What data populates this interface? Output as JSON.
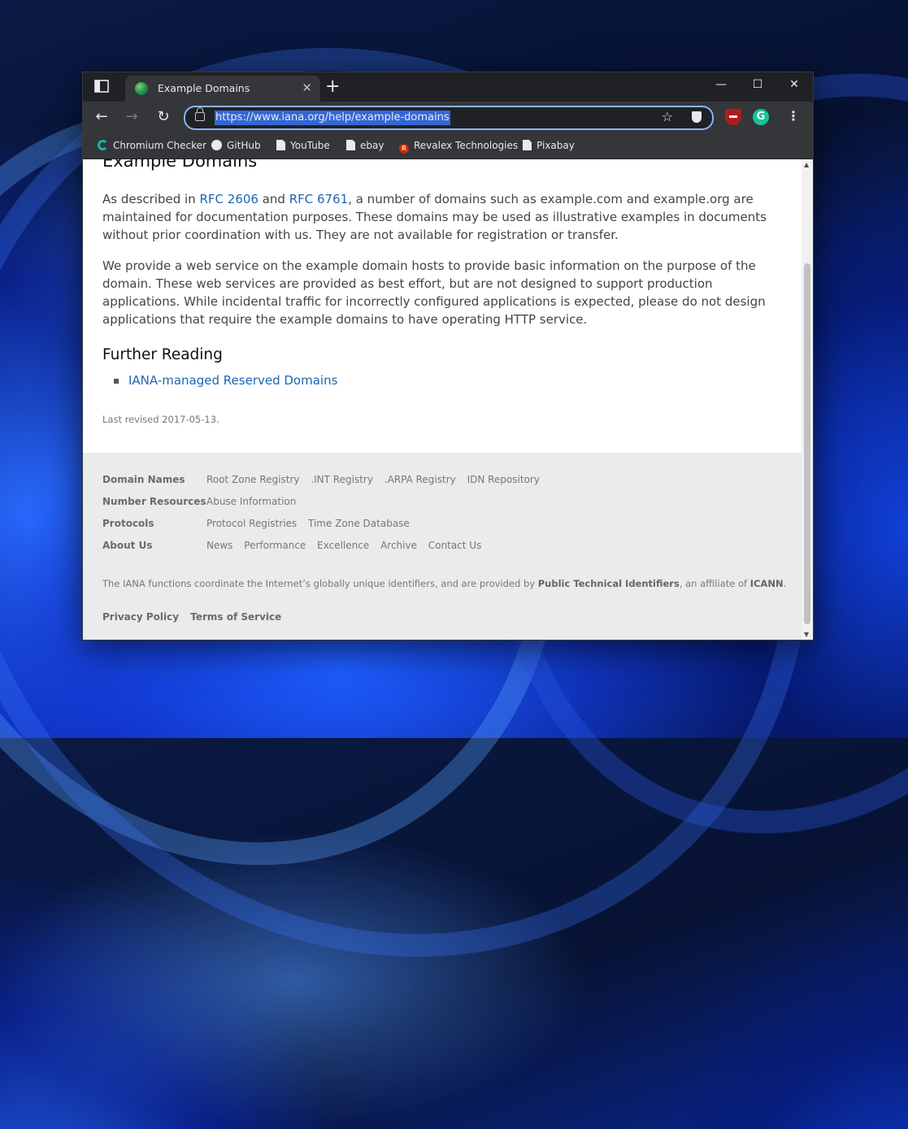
{
  "browser": {
    "tab_title": "Example Domains",
    "url": "https://www.iana.org/help/example-domains",
    "new_tab": "+",
    "tab_close": "✕",
    "minimize": "—",
    "maximize": "☐",
    "close": "✕",
    "back": "←",
    "forward": "→",
    "reload": "↻",
    "star": "☆",
    "menu": "⋮",
    "grammarly": "G",
    "bookmarks": [
      "Chromium Checker",
      "GitHub",
      "YouTube",
      "ebay",
      "Revalex Technologies",
      "Pixabay"
    ],
    "revalex_glyph": "R"
  },
  "page": {
    "title": "Example Domains",
    "p1": {
      "pre": "As described in ",
      "link1": "RFC 2606",
      "mid": " and ",
      "link2": "RFC 6761",
      "post": ", a number of domains such as example.com and example.org are maintained for documentation purposes. These domains may be used as illustrative examples in documents without prior coordination with us. They are not available for registration or transfer."
    },
    "p2": "We provide a web service on the example domain hosts to provide basic information on the purpose of the domain. These web services are provided as best effort, but are not designed to support production applications. While incidental traffic for incorrectly configured applications is expected, please do not design applications that require the example domains to have operating HTTP service.",
    "further_reading": "Further Reading",
    "reading_link": "IANA-managed Reserved Domains",
    "last_revised": "Last revised 2017-05-13."
  },
  "footer": {
    "sections": [
      {
        "head": "Domain Names",
        "links": [
          "Root Zone Registry",
          ".INT Registry",
          ".ARPA Registry",
          "IDN Repository"
        ]
      },
      {
        "head": "Number Resources",
        "links": [
          "Abuse Information"
        ]
      },
      {
        "head": "Protocols",
        "links": [
          "Protocol Registries",
          "Time Zone Database"
        ]
      },
      {
        "head": "About Us",
        "links": [
          "News",
          "Performance",
          "Excellence",
          "Archive",
          "Contact Us"
        ]
      }
    ],
    "note_pre": "The IANA functions coordinate the Internet’s globally unique identifiers, and are provided by ",
    "note_pti": "Public Technical Identifiers",
    "note_mid": ", an affiliate of ",
    "note_icann": "ICANN",
    "note_end": ".",
    "privacy": "Privacy Policy",
    "terms": "Terms of Service"
  },
  "scrollbar": {
    "up": "▲",
    "down": "▼"
  }
}
